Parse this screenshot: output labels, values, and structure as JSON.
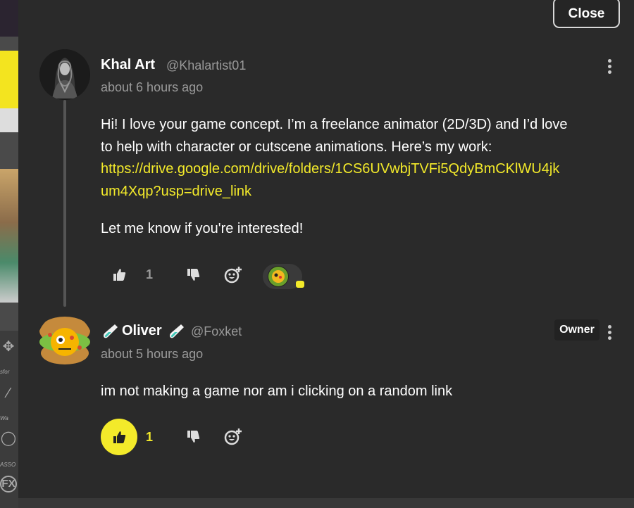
{
  "modal": {
    "close_label": "Close"
  },
  "background_tools": {
    "labels": [
      "sfor",
      "Wa",
      "ASSO",
      "FX"
    ]
  },
  "comments": [
    {
      "author_name": "Khal Art",
      "author_handle": "@Khalartist01",
      "timestamp": "about 6 hours ago",
      "body_line1": "Hi! I love your game concept. I’m a freelance animator (2D/3D) and I’d love",
      "body_line2": "to help with character or cutscene animations. Here’s my work:",
      "link_line1": "https://drive.google.com/drive/folders/1CS6UVwbjTVFi5QdyBmCKlWU4jk",
      "link_line2": "um4Xqp?usp=drive_link",
      "body_line3": "Let me know if you're interested!",
      "like_count": "1",
      "reactions": [
        "thumbs-up-icon",
        "thumbs-down-icon",
        "add-reaction-icon"
      ]
    },
    {
      "author_prefix_icon": "test-tube-icon",
      "author_name": "Oliver",
      "author_handle": "@Foxket",
      "badge": "Owner",
      "timestamp": "about 5 hours ago",
      "body": "im not making a game nor am i clicking on a random link",
      "like_count": "1",
      "liked": true
    }
  ],
  "colors": {
    "accent": "#f3ea2a",
    "panel": "#2a2a2a",
    "muted": "#9a9a9a"
  }
}
